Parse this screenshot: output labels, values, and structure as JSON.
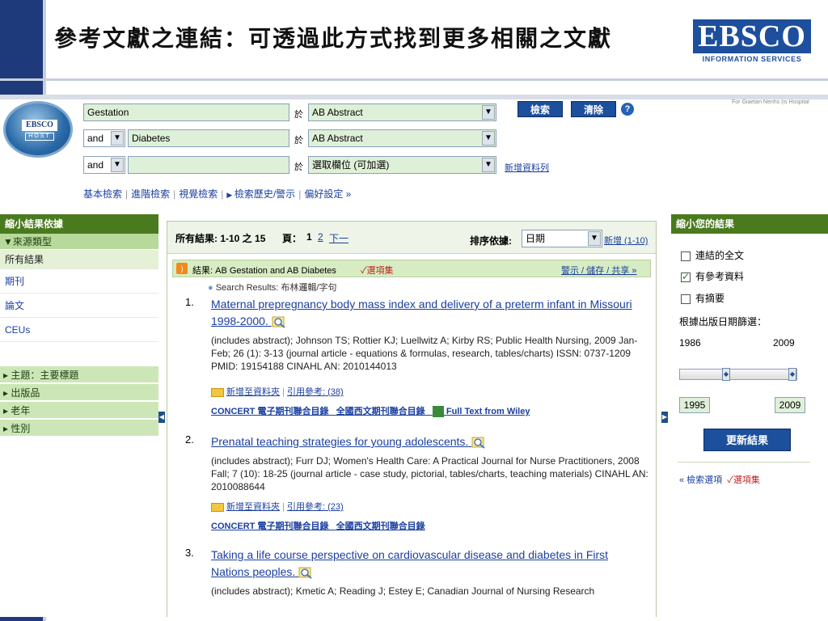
{
  "slide": {
    "title": "參考文獻之連結：可透過此方式找到更多相關之文獻",
    "logo_word": "EBSCO",
    "logo_sub": "INFORMATION SERVICES"
  },
  "host_logo": {
    "top": "EBSCO",
    "bottom": "HOST"
  },
  "corner_note": "For Giaetan Nenhs (is Hospital",
  "search": {
    "rows": [
      {
        "bool": "",
        "term": "Gestation",
        "in": "於",
        "field": "AB Abstract"
      },
      {
        "bool": "and",
        "term": "Diabetes",
        "in": "於",
        "field": "AB Abstract"
      },
      {
        "bool": "and",
        "term": "",
        "in": "於",
        "field": "選取欄位 (可加選)"
      }
    ],
    "search_btn": "檢索",
    "clear_btn": "清除",
    "help": "?",
    "add_row": "新增資料列"
  },
  "nav": {
    "basic": "基本檢索",
    "advanced": "進階檢索",
    "visual": "視覺檢索",
    "history": "檢索歷史/警示",
    "prefs": "偏好設定 »",
    "sep": "|"
  },
  "left": {
    "header": "縮小結果依據",
    "source_type": "▼來源類型",
    "items": [
      "所有結果",
      "期刊",
      "論文",
      "CEUs"
    ],
    "facets": [
      "主題：主要標題",
      "出版品",
      "老年",
      "性別"
    ]
  },
  "main": {
    "summary": "所有結果: 1-10 之 15",
    "pages_label": "頁：",
    "page_current": "1",
    "page_2": "2",
    "next": "下一",
    "sort_label": "排序依據:",
    "sort_value": "日期",
    "add_link": "新增 (1-10)",
    "results_label": "結果: AB Gestation and AB Diabetes",
    "selected": "✓選項集",
    "alert_links": "警示 / 儲存 / 共享 »",
    "search_results": "Search Results: 布林邏輯/字句"
  },
  "results": [
    {
      "num": "1.",
      "title": "Maternal prepregnancy body mass index and delivery of a preterm infant in Missouri 1998-2000.",
      "body": "(includes abstract); Johnson TS; Rottier KJ; Luellwitz A; Kirby RS; Public Health Nursing, 2009 Jan-Feb; 26 (1): 3-13 (journal article - equations & formulas, research, tables/charts) ISSN: 0737-1209 PMID: 19154188 CINAHL AN: 2010144013",
      "add_folder": "新增至資料夾",
      "cited": "引用參考: (38)",
      "concert": "CONCERT 電子期刊聯合目錄",
      "union": "全國西文期刊聯合目錄",
      "fulltext": "Full Text from Wiley"
    },
    {
      "num": "2.",
      "title": "Prenatal teaching strategies for young adolescents.",
      "body": "(includes abstract); Furr DJ; Women's Health Care: A Practical Journal for Nurse Practitioners, 2008 Fall; 7 (10): 18-25 (journal article - case study, pictorial, tables/charts, teaching materials) CINAHL AN: 2010088644",
      "add_folder": "新增至資料夾",
      "cited": "引用參考: (23)",
      "concert": "CONCERT 電子期刊聯合目錄",
      "union": "全國西文期刊聯合目錄"
    },
    {
      "num": "3.",
      "title": "Taking a life course perspective on cardiovascular disease and diabetes in First Nations peoples.",
      "body": "(includes abstract); Kmetic A; Reading J; Estey E; Canadian Journal of Nursing Research"
    }
  ],
  "right": {
    "header": "縮小您的結果",
    "full_text": "連結的全文",
    "full_text_checked": false,
    "references": "有參考資料",
    "references_checked": true,
    "abstracts": "有摘要",
    "abstracts_checked": false,
    "pub_date_label": "根據出版日期篩選：",
    "min_year": "1986",
    "max_year": "2009",
    "from_year": "1995",
    "to_year": "2009",
    "update_btn": "更新結果",
    "search_options": "« 檢索選項",
    "selected": "✓選項集"
  },
  "colors": {
    "brand": "#1d4f9c",
    "pane_green": "#4a7a1e",
    "link": "#1a3fa0"
  }
}
